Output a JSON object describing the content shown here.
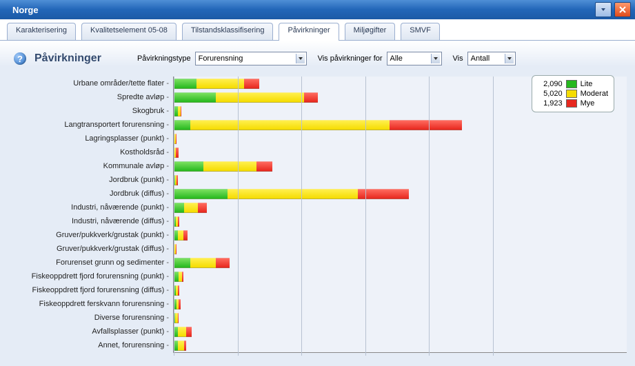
{
  "window": {
    "title": "Norge"
  },
  "tabs": [
    {
      "label": "Karakterisering",
      "active": false
    },
    {
      "label": "Kvalitetselement 05-08",
      "active": false
    },
    {
      "label": "Tilstandsklassifisering",
      "active": false
    },
    {
      "label": "Påvirkninger",
      "active": true
    },
    {
      "label": "Miljøgifter",
      "active": false
    },
    {
      "label": "SMVF",
      "active": false
    }
  ],
  "header": {
    "title": "Påvirkninger",
    "type_label": "Påvirkningstype",
    "type_value": "Forurensning",
    "for_label": "Vis påvirkninger for",
    "for_value": "Alle",
    "vis_label": "Vis",
    "vis_value": "Antall"
  },
  "legend": {
    "items": [
      {
        "count": "2,090",
        "color": "lite",
        "label": "Lite"
      },
      {
        "count": "5,020",
        "color": "moderat",
        "label": "Moderat"
      },
      {
        "count": "1,923",
        "color": "mye",
        "label": "Mye"
      }
    ]
  },
  "chart_data": {
    "type": "bar",
    "orientation": "horizontal",
    "xlabel": "",
    "ylabel": "",
    "x_max": 2700,
    "series_names": [
      "Lite",
      "Moderat",
      "Mye"
    ],
    "series_colors": {
      "Lite": "#26b81e",
      "Moderat": "#f5dc00",
      "Mye": "#e7281f"
    },
    "categories": [
      "Urbane områder/tette flater",
      "Spredte avløp",
      "Skogbruk",
      "Langtransportert forurensning",
      "Lagringsplasser (punkt)",
      "Kostholdsråd",
      "Kommunale avløp",
      "Jordbruk (punkt)",
      "Jordbruk (diffus)",
      "Industri, nåværende (punkt)",
      "Industri, nåværende (diffus)",
      "Gruver/pukkverk/grustak (punkt)",
      "Gruver/pukkverk/grustak (diffus)",
      "Forurenset grunn og sedimenter",
      "Fiskeoppdrett fjord forurensning (punkt)",
      "Fiskeoppdrett fjord forurensning (diffus)",
      "Fiskeoppdrett ferskvann forurensning",
      "Diverse forurensning",
      "Avfallsplasser (punkt)",
      "Annet, forurensning"
    ],
    "series": [
      {
        "name": "Lite",
        "values": [
          180,
          330,
          30,
          130,
          8,
          5,
          230,
          10,
          420,
          80,
          15,
          30,
          8,
          130,
          40,
          15,
          20,
          10,
          35,
          35
        ]
      },
      {
        "name": "Moderat",
        "values": [
          370,
          690,
          25,
          1560,
          8,
          10,
          420,
          12,
          1020,
          110,
          20,
          45,
          10,
          200,
          25,
          20,
          20,
          20,
          60,
          45
        ]
      },
      {
        "name": "Mye",
        "values": [
          120,
          110,
          5,
          570,
          5,
          25,
          120,
          8,
          400,
          70,
          10,
          35,
          5,
          110,
          10,
          10,
          15,
          10,
          45,
          15
        ]
      }
    ]
  }
}
